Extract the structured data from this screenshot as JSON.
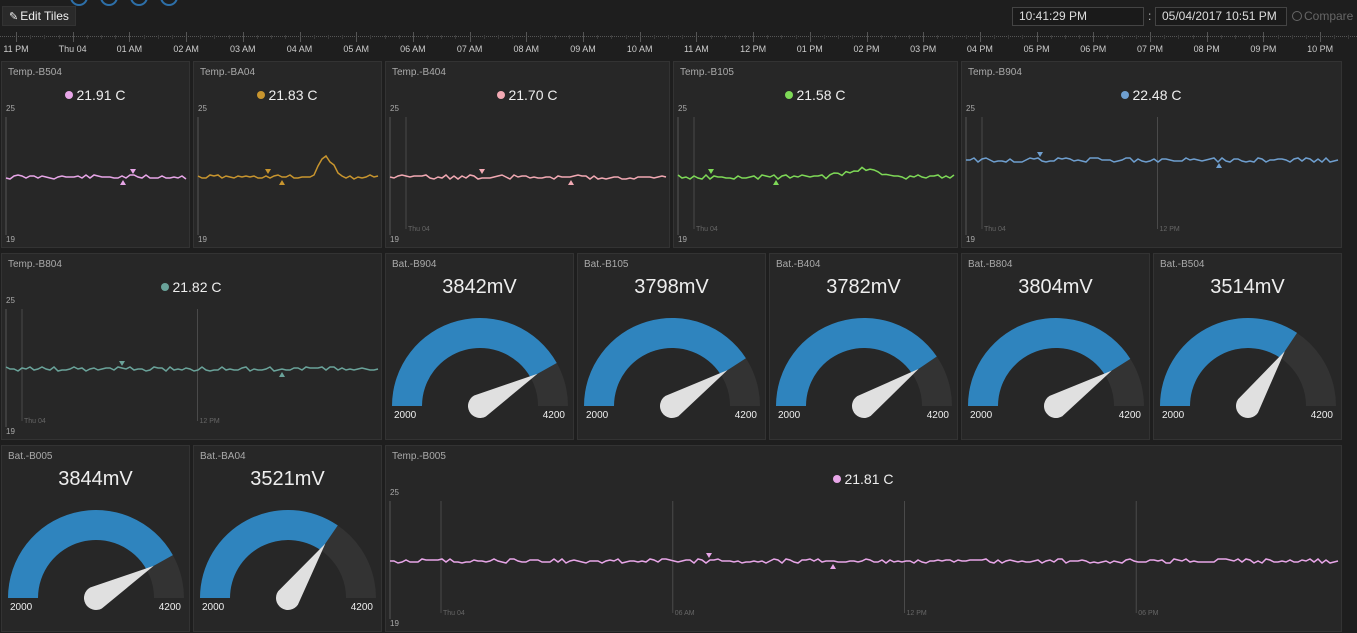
{
  "toolbar": {
    "edit_tiles_label": "Edit Tiles",
    "start_time": "10:41:29 PM",
    "separator": ":",
    "end_datetime": "05/04/2017 10:51 PM",
    "compare_label": "Compare"
  },
  "timeline": {
    "labels": [
      "11 PM",
      "Thu 04",
      "01 AM",
      "02 AM",
      "03 AM",
      "04 AM",
      "05 AM",
      "06 AM",
      "07 AM",
      "08 AM",
      "09 AM",
      "10 AM",
      "11 AM",
      "12 PM",
      "01 PM",
      "02 PM",
      "03 PM",
      "04 PM",
      "05 PM",
      "06 PM",
      "07 PM",
      "08 PM",
      "09 PM",
      "10 PM"
    ]
  },
  "temp_tiles": [
    {
      "title": "Temp.-B504",
      "value": "21.91 C",
      "color": "#e8a6e8",
      "y_max": "25",
      "y_min": "19",
      "markers": []
    },
    {
      "title": "Temp.-BA04",
      "value": "21.83 C",
      "color": "#c8952e",
      "y_max": "25",
      "y_min": "19",
      "markers": []
    },
    {
      "title": "Temp.-B404",
      "value": "21.70 C",
      "color": "#f2a9b3",
      "y_max": "25",
      "y_min": "19",
      "markers": [
        "Thu 04"
      ]
    },
    {
      "title": "Temp.-B105",
      "value": "21.58 C",
      "color": "#7ed957",
      "y_max": "25",
      "y_min": "19",
      "markers": [
        "Thu 04"
      ]
    },
    {
      "title": "Temp.-B904",
      "value": "22.48 C",
      "color": "#6f9fcf",
      "y_max": "25",
      "y_min": "19",
      "markers": [
        "Thu 04",
        "12 PM"
      ]
    },
    {
      "title": "Temp.-B804",
      "value": "21.82 C",
      "color": "#6aa39a",
      "y_max": "25",
      "y_min": "19",
      "markers": [
        "Thu 04",
        "12 PM"
      ]
    },
    {
      "title": "Temp.-B005",
      "value": "21.81 C",
      "color": "#e8a6e8",
      "y_max": "25",
      "y_min": "19",
      "markers": [
        "Thu 04",
        "06 AM",
        "12 PM",
        "06 PM"
      ]
    }
  ],
  "gauges": [
    {
      "title": "Bat.-B904",
      "value": 3842,
      "display": "3842mV",
      "min": "2000",
      "max": "4200"
    },
    {
      "title": "Bat.-B105",
      "value": 3798,
      "display": "3798mV",
      "min": "2000",
      "max": "4200"
    },
    {
      "title": "Bat.-B404",
      "value": 3782,
      "display": "3782mV",
      "min": "2000",
      "max": "4200"
    },
    {
      "title": "Bat.-B804",
      "value": 3804,
      "display": "3804mV",
      "min": "2000",
      "max": "4200"
    },
    {
      "title": "Bat.-B504",
      "value": 3514,
      "display": "3514mV",
      "min": "2000",
      "max": "4200"
    },
    {
      "title": "Bat.-B005",
      "value": 3844,
      "display": "3844mV",
      "min": "2000",
      "max": "4200"
    },
    {
      "title": "Bat.-BA04",
      "value": 3521,
      "display": "3521mV",
      "min": "2000",
      "max": "4200"
    }
  ],
  "colors": {
    "gauge_fill": "#2f84be",
    "gauge_track": "#333333",
    "needle": "#e0e0e0"
  }
}
